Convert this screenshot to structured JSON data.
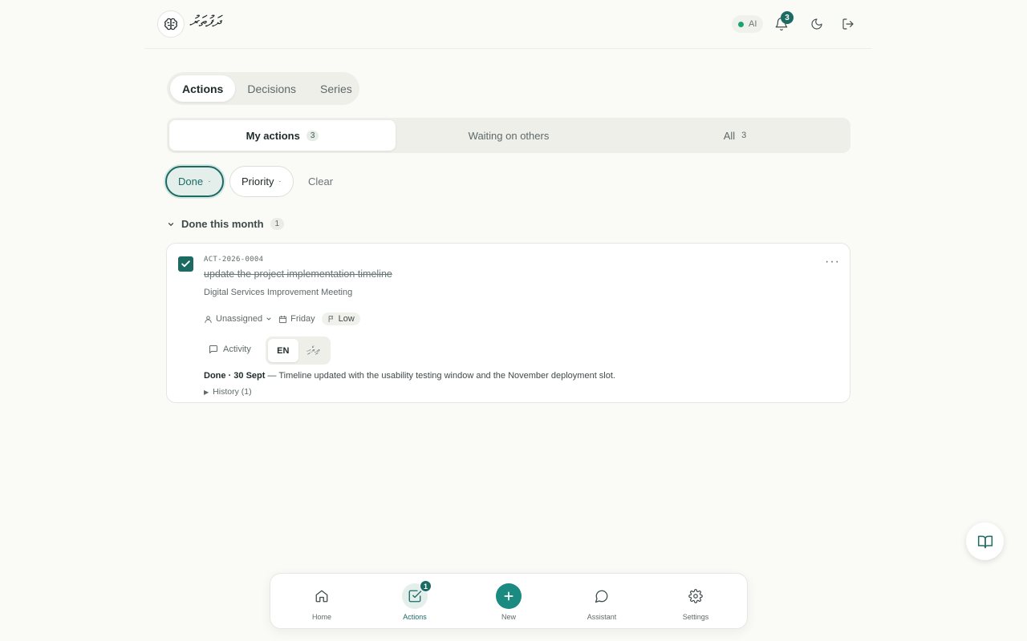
{
  "header": {
    "app_title": "ދަފުތަރު",
    "ai_label": "AI",
    "notifications_count": "3",
    "ai_status_color": "#1aa36f",
    "accent_color": "#1b6b63"
  },
  "top_tabs": [
    {
      "label": "Actions",
      "active": true
    },
    {
      "label": "Decisions",
      "active": false
    },
    {
      "label": "Series",
      "active": false
    }
  ],
  "sub_tabs": [
    {
      "label": "My actions",
      "count": "3",
      "active": true
    },
    {
      "label": "Waiting on others",
      "count": "",
      "active": false
    },
    {
      "label": "All",
      "count": "3",
      "active": false
    }
  ],
  "filters": {
    "done_label": "Done",
    "priority_label": "Priority",
    "clear_label": "Clear"
  },
  "section": {
    "title": "Done this month",
    "count": "1"
  },
  "card": {
    "id": "ACT-2026-0004",
    "title": "update the project implementation timeline",
    "meeting": "Digital Services Improvement Meeting",
    "assignee": "Unassigned",
    "due": "Friday",
    "priority": "Low",
    "activity_label": "Activity",
    "lang_en": "EN",
    "lang_dv": "ދިވެހި",
    "note_status": "Done · 30 Sept",
    "note_text": " — Timeline updated with the usability testing window and the November deployment slot.",
    "history_label": "History (1)"
  },
  "bottom_nav": [
    {
      "label": "Home",
      "icon": "home-icon"
    },
    {
      "label": "Actions",
      "icon": "checkbox-icon",
      "badge": "1",
      "active": true
    },
    {
      "label": "New",
      "icon": "plus-icon"
    },
    {
      "label": "Assistant",
      "icon": "chat-icon"
    },
    {
      "label": "Settings",
      "icon": "gear-icon"
    }
  ]
}
